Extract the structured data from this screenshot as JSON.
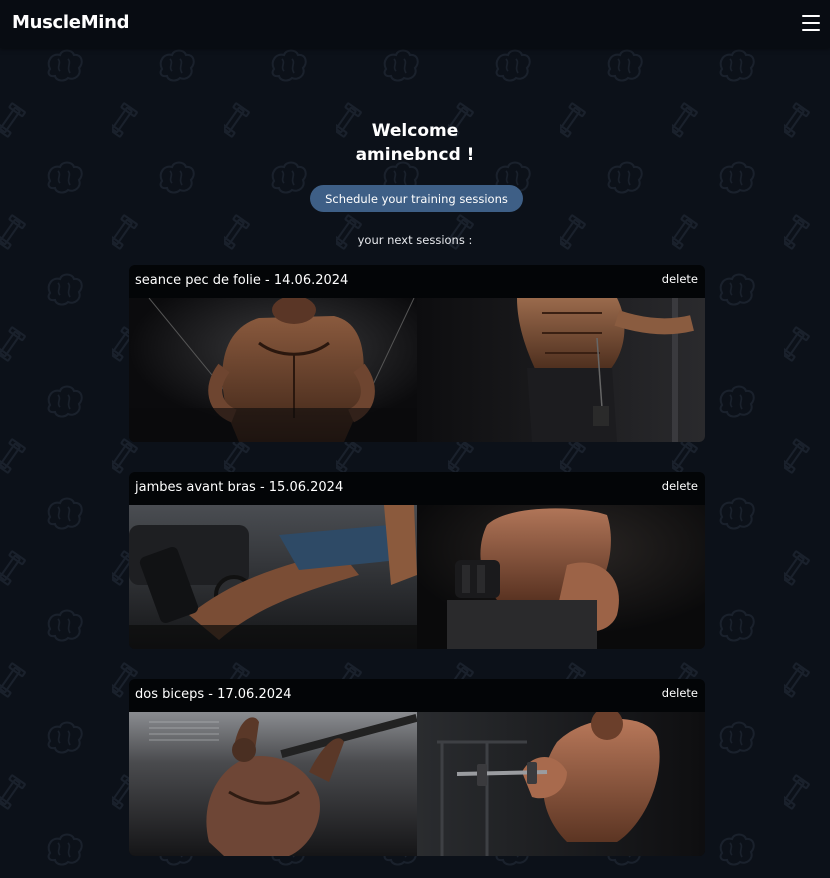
{
  "header": {
    "app_title": "MuscleMind",
    "menu_icon": "hamburger-menu-icon"
  },
  "welcome": {
    "line1": "Welcome",
    "line2": "aminebncd !"
  },
  "actions": {
    "schedule_label": "Schedule your training sessions"
  },
  "sessions_heading": "your next sessions :",
  "sessions": [
    {
      "title": "seance pec de folie - 14.06.2024",
      "delete_label": "delete",
      "photos": [
        "chest-cable-fly-photo",
        "abs-triceps-photo"
      ]
    },
    {
      "title": "jambes avant bras - 15.06.2024",
      "delete_label": "delete",
      "photos": [
        "leg-extension-photo",
        "dumbbell-curl-photo"
      ]
    },
    {
      "title": "dos biceps - 17.06.2024",
      "delete_label": "delete",
      "photos": [
        "pull-up-back-photo",
        "barbell-curl-photo"
      ]
    }
  ],
  "colors": {
    "background": "#0c1119",
    "header": "#080c12",
    "card": "#030507",
    "button": "#3e5f86"
  }
}
